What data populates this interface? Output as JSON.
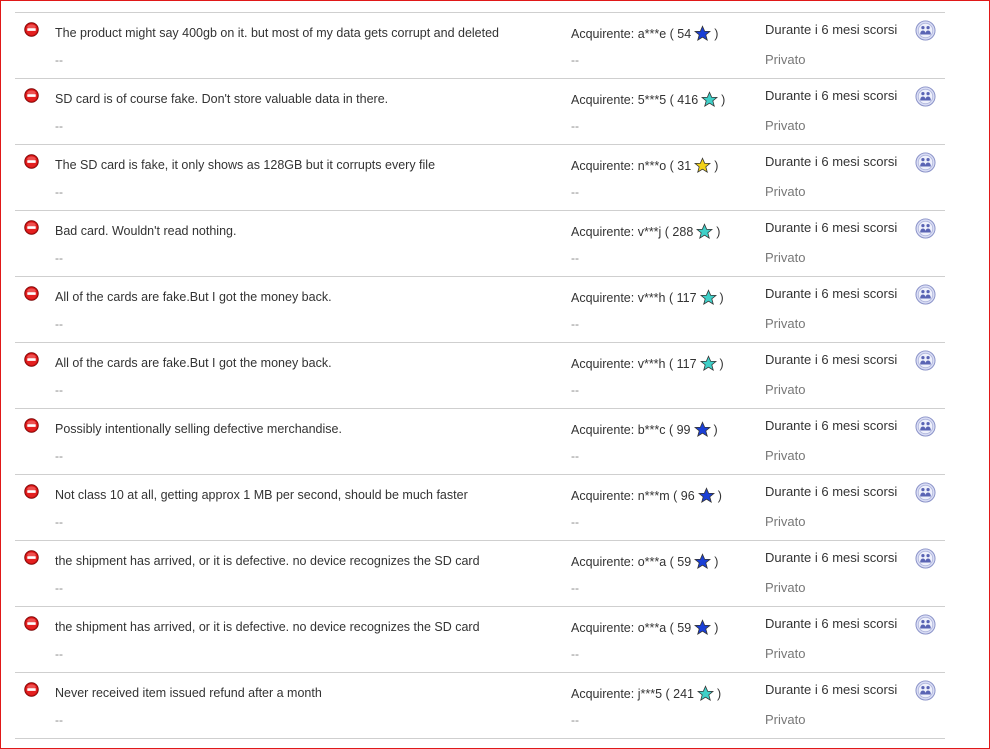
{
  "colors": {
    "negative": "#d81414",
    "star_blue": "#1a3fd6",
    "star_teal": "#3fd0c8",
    "star_yellow": "#f2d21a",
    "frame": "#e01818"
  },
  "reviews": [
    {
      "comment": "The product might say 400gb on it. but most of my data gets corrupt and deleted",
      "comment_extra": "--",
      "buyer_prefix": "Acquirente: a***e ( 54",
      "buyer_suffix": ")",
      "star": "star_blue",
      "buyer_extra": "--",
      "period": "Durante i 6 mesi scorsi",
      "privacy": "Privato"
    },
    {
      "comment": "SD card is of course fake. Don't store valuable data in there.",
      "comment_extra": "--",
      "buyer_prefix": "Acquirente: 5***5 ( 416",
      "buyer_suffix": ")",
      "star": "star_teal",
      "buyer_extra": "--",
      "period": "Durante i 6 mesi scorsi",
      "privacy": "Privato"
    },
    {
      "comment": "The SD card is fake, it only shows as 128GB but it corrupts every file",
      "comment_extra": "--",
      "buyer_prefix": "Acquirente: n***o ( 31",
      "buyer_suffix": ")",
      "star": "star_yellow",
      "buyer_extra": "--",
      "period": "Durante i 6 mesi scorsi",
      "privacy": "Privato"
    },
    {
      "comment": "Bad card. Wouldn't read nothing.",
      "comment_extra": "--",
      "buyer_prefix": "Acquirente: v***j ( 288",
      "buyer_suffix": ")",
      "star": "star_teal",
      "buyer_extra": "--",
      "period": "Durante i 6 mesi scorsi",
      "privacy": "Privato"
    },
    {
      "comment": "All of the cards are fake.But I got the money back.",
      "comment_extra": "--",
      "buyer_prefix": "Acquirente: v***h ( 117",
      "buyer_suffix": ")",
      "star": "star_teal",
      "buyer_extra": "--",
      "period": "Durante i 6 mesi scorsi",
      "privacy": "Privato"
    },
    {
      "comment": "All of the cards are fake.But I got the money back.",
      "comment_extra": "--",
      "buyer_prefix": "Acquirente: v***h ( 117",
      "buyer_suffix": ")",
      "star": "star_teal",
      "buyer_extra": "--",
      "period": "Durante i 6 mesi scorsi",
      "privacy": "Privato"
    },
    {
      "comment": "Possibly intentionally selling defective merchandise.",
      "comment_extra": "--",
      "buyer_prefix": "Acquirente: b***c ( 99",
      "buyer_suffix": ")",
      "star": "star_blue",
      "buyer_extra": "--",
      "period": "Durante i 6 mesi scorsi",
      "privacy": "Privato"
    },
    {
      "comment": "Not class 10 at all, getting approx 1 MB per second, should be much faster",
      "comment_extra": "--",
      "buyer_prefix": "Acquirente: n***m ( 96",
      "buyer_suffix": ")",
      "star": "star_blue",
      "buyer_extra": "--",
      "period": "Durante i 6 mesi scorsi",
      "privacy": "Privato"
    },
    {
      "comment": "the shipment has arrived, or it is defective. no device recognizes the SD card",
      "comment_extra": "--",
      "buyer_prefix": "Acquirente: o***a ( 59",
      "buyer_suffix": ")",
      "star": "star_blue",
      "buyer_extra": "--",
      "period": "Durante i 6 mesi scorsi",
      "privacy": "Privato"
    },
    {
      "comment": "the shipment has arrived, or it is defective. no device recognizes the SD card",
      "comment_extra": "--",
      "buyer_prefix": "Acquirente: o***a ( 59",
      "buyer_suffix": ")",
      "star": "star_blue",
      "buyer_extra": "--",
      "period": "Durante i 6 mesi scorsi",
      "privacy": "Privato"
    },
    {
      "comment": "Never received item issued refund after a month",
      "comment_extra": "--",
      "buyer_prefix": "Acquirente: j***5 ( 241",
      "buyer_suffix": ")",
      "star": "star_teal",
      "buyer_extra": "--",
      "period": "Durante i 6 mesi scorsi",
      "privacy": "Privato"
    }
  ]
}
